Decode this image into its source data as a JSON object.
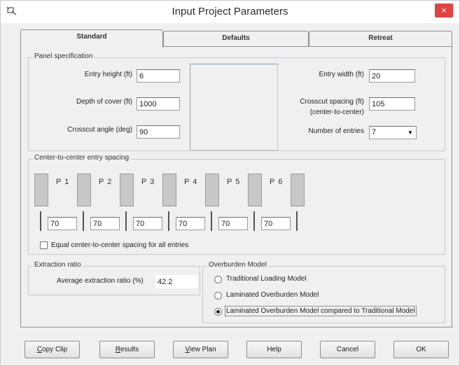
{
  "window": {
    "title": "Input Project Parameters",
    "close_glyph": "×"
  },
  "tabs": [
    "Standard",
    "Defaults",
    "Retreat"
  ],
  "panel_spec": {
    "title": "Panel specification",
    "entry_height_label": "Entry height (ft)",
    "entry_height": "6",
    "depth_label": "Depth of cover (ft)",
    "depth": "1000",
    "crosscut_angle_label": "Crosscut angle (deg)",
    "crosscut_angle": "90",
    "entry_width_label": "Entry width (ft)",
    "entry_width": "20",
    "crosscut_spacing_label": "Crosscut spacing (ft)",
    "crosscut_spacing_sub": "(center-to-center)",
    "crosscut_spacing": "105",
    "num_entries_label": "Number of entries",
    "num_entries": "7"
  },
  "spacing": {
    "title": "Center-to-center entry spacing",
    "pillars": [
      "P 1",
      "P 2",
      "P 3",
      "P 4",
      "P 5",
      "P 6"
    ],
    "values": [
      "70",
      "70",
      "70",
      "70",
      "70",
      "70"
    ],
    "equal_label": "Equal center-to-center spacing for all entries",
    "equal_checked": false
  },
  "extraction": {
    "title": "Extraction ratio",
    "label": "Average extraction ratio (%)",
    "value": "42.2"
  },
  "overburden": {
    "title": "Overburden Model",
    "options": [
      "Traditional Loading Model",
      "Laminated Overburden Model",
      "Laminated Overburden Model compared to Traditional Model"
    ],
    "selected_index": 2
  },
  "buttons": {
    "copy_clip": {
      "mnemonic": "C",
      "rest": "opy Clip"
    },
    "results": {
      "mnemonic": "R",
      "rest": "esults"
    },
    "view_plan": {
      "mnemonic": "V",
      "rest": "iew Plan"
    },
    "help": "Help",
    "cancel": "Cancel",
    "ok": "OK"
  },
  "colors": {
    "close_button": "#e04343",
    "pillar_fill": "#c8c8c8"
  }
}
